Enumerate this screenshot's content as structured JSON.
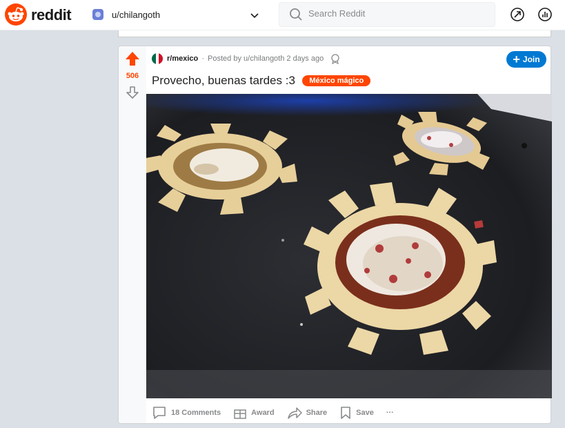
{
  "topbar": {
    "logo_text": "reddit",
    "user": {
      "name": "u/chilangoth",
      "icon": "user-avatar-icon"
    },
    "search": {
      "placeholder": "Search Reddit"
    },
    "icons": [
      "popular-icon",
      "stats-icon"
    ]
  },
  "post": {
    "subreddit": "r/mexico",
    "dot": "·",
    "posted_by": "Posted by u/chilangoth 2 days ago",
    "join_label": "Join",
    "score": "506",
    "title": "Provecho, buenas tardes :3",
    "flair": "México mágico",
    "image_description": "photo",
    "actions": {
      "comments": "18 Comments",
      "award": "Award",
      "share": "Share",
      "save": "Save",
      "more": "···"
    }
  },
  "colors": {
    "accent": "#ff4500",
    "join": "#0079d3",
    "muted": "#878a8c"
  }
}
